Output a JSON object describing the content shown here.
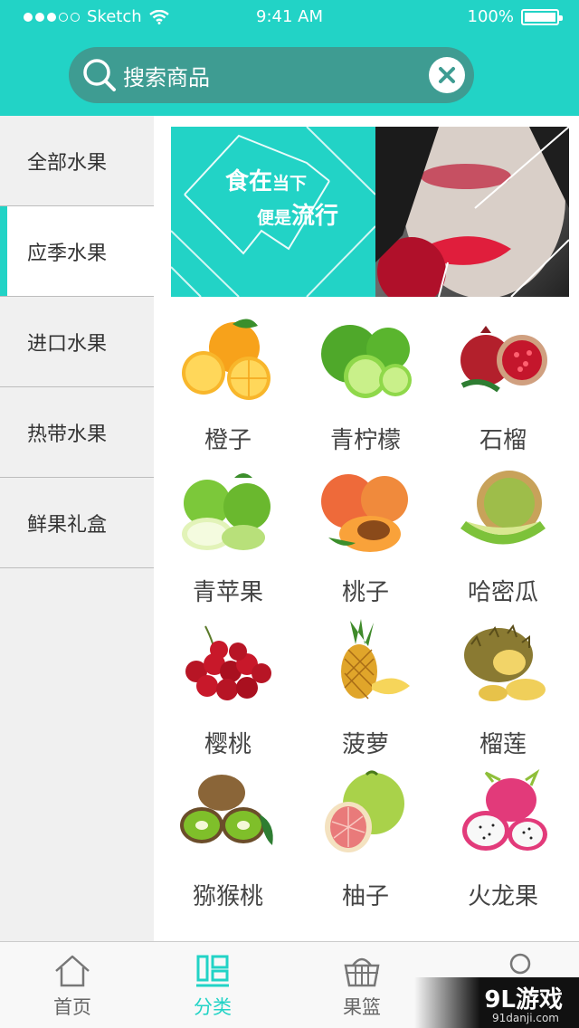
{
  "status_bar": {
    "carrier": "Sketch",
    "time": "9:41 AM",
    "battery": "100%",
    "signal_icon": "signal-dots-icon",
    "wifi_icon": "wifi-icon"
  },
  "search": {
    "placeholder": "搜索商品",
    "icon": "search-icon",
    "clear_icon": "close-circle-icon"
  },
  "sidebar": {
    "items": [
      {
        "label": "全部水果",
        "active": false
      },
      {
        "label": "应季水果",
        "active": true
      },
      {
        "label": "进口水果",
        "active": false
      },
      {
        "label": "热带水果",
        "active": false
      },
      {
        "label": "鲜果礼盒",
        "active": false
      }
    ]
  },
  "banner": {
    "line1_big": "食在",
    "line1_small": "当下",
    "line2_small": "便是",
    "line2_big": "流行"
  },
  "fruits": [
    {
      "name": "橙子"
    },
    {
      "name": "青柠檬"
    },
    {
      "name": "石榴"
    },
    {
      "name": "青苹果"
    },
    {
      "name": "桃子"
    },
    {
      "name": "哈密瓜"
    },
    {
      "name": "樱桃"
    },
    {
      "name": "菠萝"
    },
    {
      "name": "榴莲"
    },
    {
      "name": "猕猴桃"
    },
    {
      "name": "柚子"
    },
    {
      "name": "火龙果"
    }
  ],
  "tabbar": {
    "tabs": [
      {
        "label": "首页",
        "icon": "home-icon",
        "active": false
      },
      {
        "label": "分类",
        "icon": "category-icon",
        "active": true
      },
      {
        "label": "果篮",
        "icon": "basket-icon",
        "active": false
      },
      {
        "label": "",
        "icon": "user-icon",
        "active": false
      }
    ]
  },
  "watermark": {
    "logo": "9L游戏",
    "url": "91danji.com"
  },
  "colors": {
    "accent": "#22d3c6",
    "search_bg": "#3e9c92",
    "sidebar_bg": "#f0f0f0"
  }
}
